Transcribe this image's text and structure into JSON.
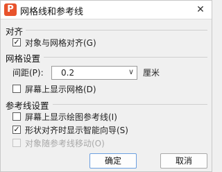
{
  "window": {
    "title": "网格线和参考线",
    "logo": "P",
    "close_glyph": "✕",
    "accent": "#e8532c"
  },
  "snap": {
    "title": "对齐",
    "snap_to_grid": {
      "label": "对象与网格对齐(G)",
      "checked": true
    }
  },
  "grid": {
    "title": "网格设置",
    "spacing_label": "间距(P):",
    "spacing_value": "0.2",
    "spacing_unit": "厘米",
    "show_grid": {
      "label": "屏幕上显示网格(D)",
      "checked": false
    }
  },
  "guides": {
    "title": "参考线设置",
    "show_drawing_guides": {
      "label": "屏幕上显示绘图参考线(I)",
      "checked": false
    },
    "smart_guides": {
      "label": "形状对齐时显示智能向导(S)",
      "checked": true
    },
    "move_with_guides": {
      "label": "对象随参考线移动(O)",
      "checked": false,
      "disabled": true
    }
  },
  "buttons": {
    "ok": "确定",
    "cancel": "取消"
  },
  "icons": {
    "dropdown": "chevron-down-icon",
    "check": "check-icon"
  }
}
